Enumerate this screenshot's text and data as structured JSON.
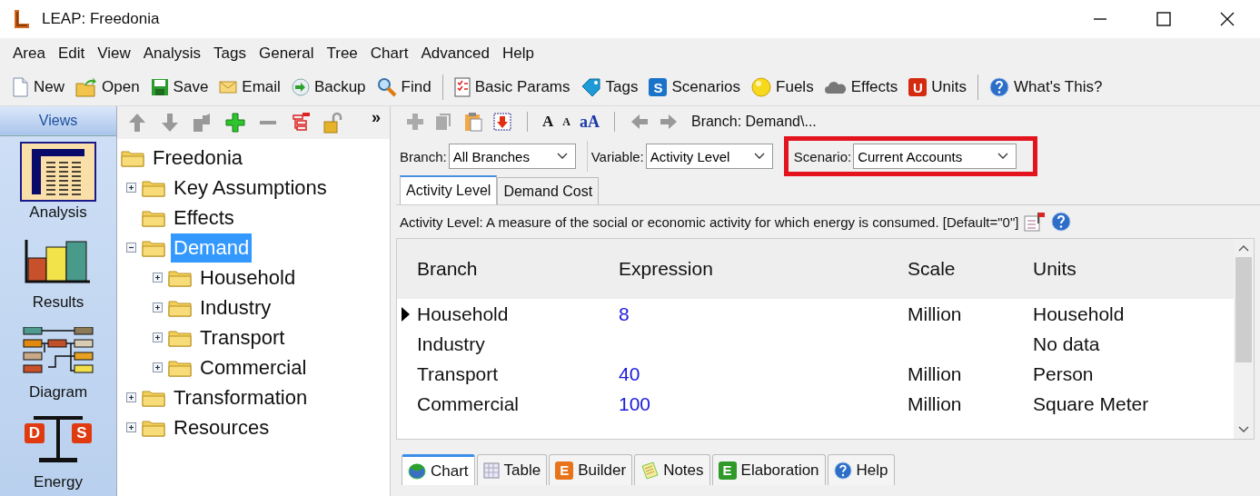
{
  "window": {
    "title": "LEAP: Freedonia"
  },
  "menu": [
    "Area",
    "Edit",
    "View",
    "Analysis",
    "Tags",
    "General",
    "Tree",
    "Chart",
    "Advanced",
    "Help"
  ],
  "toolbar": [
    [
      {
        "label": "New"
      },
      {
        "label": "Open"
      },
      {
        "label": "Save"
      },
      {
        "label": "Email"
      },
      {
        "label": "Backup"
      },
      {
        "label": "Find"
      }
    ],
    [
      {
        "label": "Basic Params"
      },
      {
        "label": "Tags"
      },
      {
        "icon_text": "S",
        "label": "Scenarios"
      },
      {
        "label": "Fuels"
      },
      {
        "label": "Effects"
      },
      {
        "icon_text": "U",
        "label": "Units"
      }
    ],
    [
      {
        "label": "What's This?"
      }
    ]
  ],
  "views": {
    "title": "Views",
    "items": [
      {
        "label": "Analysis",
        "selected": true
      },
      {
        "label": "Results",
        "selected": false
      },
      {
        "label": "Diagram",
        "selected": false
      },
      {
        "label": "Energy",
        "icon_text": [
          "D",
          "S"
        ],
        "selected": false
      }
    ]
  },
  "tree_toolbar": {
    "more": "»"
  },
  "tree": [
    {
      "label": "Freedonia",
      "selected": false,
      "children": [
        {
          "label": "Key Assumptions",
          "kind": "branch",
          "expanded": false,
          "selected": false
        },
        {
          "label": "Effects",
          "kind": "leaf",
          "selected": false
        },
        {
          "label": "Demand",
          "kind": "branch",
          "expanded": true,
          "selected": true,
          "children": [
            {
              "label": "Household",
              "kind": "branch",
              "expanded": false,
              "selected": false
            },
            {
              "label": "Industry",
              "kind": "branch",
              "expanded": false,
              "selected": false
            },
            {
              "label": "Transport",
              "kind": "branch",
              "expanded": false,
              "selected": false
            },
            {
              "label": "Commercial",
              "kind": "branch",
              "expanded": false,
              "selected": false
            }
          ]
        },
        {
          "label": "Transformation",
          "kind": "branch",
          "expanded": false,
          "selected": false
        },
        {
          "label": "Resources",
          "kind": "branch",
          "expanded": false,
          "selected": false
        }
      ]
    }
  ],
  "editor_toolbar": {
    "font_buttons": [
      "A",
      "A",
      "aA"
    ],
    "breadcrumb": "Branch: Demand\\..."
  },
  "filters": [
    {
      "label": "Branch:",
      "value": "All Branches",
      "highlighted": false
    },
    {
      "label": "Variable:",
      "value": "Activity Level",
      "highlighted": false
    },
    {
      "label": "Scenario:",
      "value": "Current Accounts",
      "highlighted": true
    }
  ],
  "tabs": [
    {
      "label": "Activity Level",
      "selected": true
    },
    {
      "label": "Demand Cost",
      "selected": false
    }
  ],
  "description": "Activity Level: A measure of the social or economic activity for which energy is consumed. [Default=\"0\"]",
  "table": {
    "columns": [
      "Branch",
      "Expression",
      "Scale",
      "Units"
    ],
    "rows": [
      {
        "current": true,
        "cells": [
          "Household",
          "8",
          "Million",
          "Household"
        ]
      },
      {
        "current": false,
        "cells": [
          "Industry",
          "",
          "",
          "No data"
        ]
      },
      {
        "current": false,
        "cells": [
          "Transport",
          "40",
          "Million",
          "Person"
        ]
      },
      {
        "current": false,
        "cells": [
          "Commercial",
          "100",
          "Million",
          "Square Meter"
        ]
      }
    ]
  },
  "bottom_tabs": [
    {
      "label": "Chart",
      "selected": true
    },
    {
      "label": "Table",
      "selected": false
    },
    {
      "icon_text": "E",
      "label": "Builder",
      "selected": false
    },
    {
      "label": "Notes",
      "selected": false
    },
    {
      "icon_text": "E",
      "label": "Elaboration",
      "selected": false
    },
    {
      "label": "Help",
      "selected": false
    }
  ]
}
